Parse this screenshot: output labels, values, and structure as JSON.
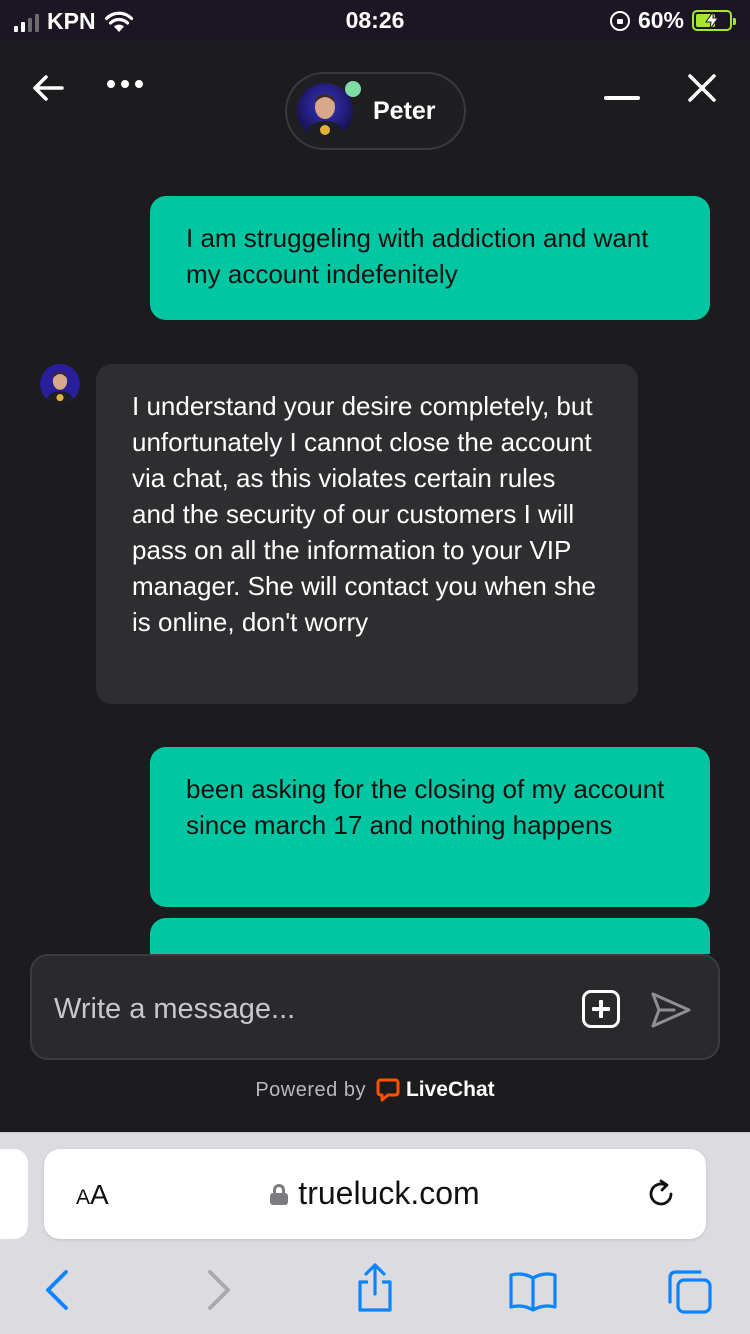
{
  "status_bar": {
    "carrier": "KPN",
    "time": "08:26",
    "battery_percent": "60%",
    "battery_level": 0.6,
    "icons": [
      "signal-icon",
      "wifi-icon",
      "orientation-lock-icon",
      "battery-charging-icon"
    ]
  },
  "header": {
    "agent_name": "Peter",
    "agent_online": true,
    "icons": [
      "back-arrow-icon",
      "more-icon",
      "minimize-icon",
      "close-icon"
    ]
  },
  "messages": [
    {
      "from": "visitor",
      "text": "I am struggeling with addiction and want my account indefenitely"
    },
    {
      "from": "agent",
      "text": "I understand your desire completely, but unfortunately I cannot close the account via chat, as this violates certain rules and the security of our customers I will pass on all the information to your VIP manager. She will contact you when she is online, don't worry"
    },
    {
      "from": "visitor",
      "text": "been asking for the closing of my account since march 17 and nothing happens"
    },
    {
      "from": "visitor",
      "text": ""
    }
  ],
  "composer": {
    "placeholder": "Write a message...",
    "value": "",
    "icons": [
      "add-attachment-icon",
      "send-icon"
    ]
  },
  "footer": {
    "powered_by": "Powered by",
    "brand": "LiveChat",
    "brand_color": "#ff5100"
  },
  "browser": {
    "aa_label_big": "A",
    "aa_label_small": "A",
    "url": "trueluck.com",
    "accent_color": "#0a84ff",
    "toolbar_icons": [
      "back-icon",
      "forward-icon",
      "share-icon",
      "bookmarks-icon",
      "tabs-icon"
    ]
  },
  "colors": {
    "visitor_bubble": "#00c7a2",
    "agent_bubble": "#2e2e30",
    "background": "#1c1c1e"
  }
}
